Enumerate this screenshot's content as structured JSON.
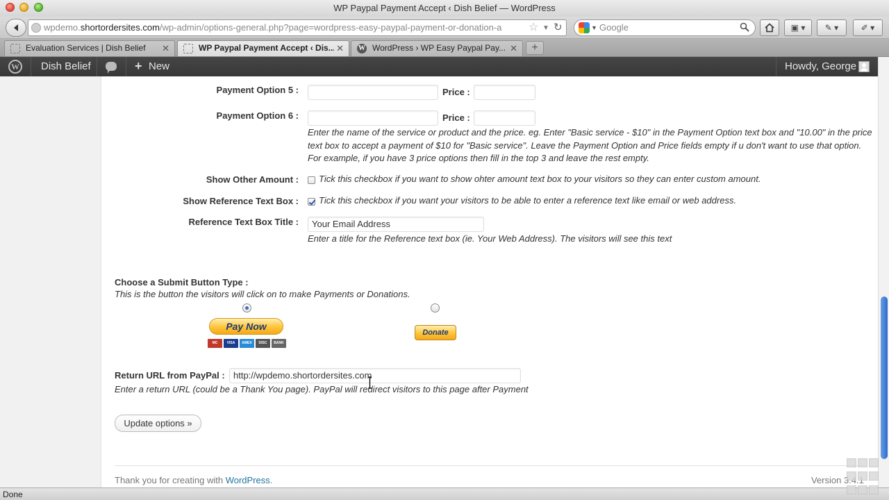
{
  "window": {
    "title": "WP Paypal Payment Accept ‹ Dish Belief — WordPress"
  },
  "navbar": {
    "url_prefix": "wpdemo.",
    "url_domain": "shortordersites.com",
    "url_path": "/wp-admin/options-general.php?page=wordpress-easy-paypal-payment-or-donation-a",
    "search_placeholder": "Google"
  },
  "tabs": [
    {
      "label": "Evaluation Services | Dish Belief",
      "active": false,
      "icon": "dashed-page-icon"
    },
    {
      "label": "WP Paypal Payment Accept ‹ Dis...",
      "active": true,
      "icon": "dashed-page-icon"
    },
    {
      "label": "WordPress › WP Easy Paypal Pay...",
      "active": false,
      "icon": "wordpress-icon"
    }
  ],
  "tab_close": "✕",
  "new_tab": "+",
  "adminbar": {
    "site_name": "Dish Belief",
    "new_label": "New",
    "howdy": "Howdy, George"
  },
  "form": {
    "option5_label": "Payment Option 5 :",
    "option6_label": "Payment Option 6 :",
    "price_label": "Price :",
    "option5_value": "",
    "option5_price": "",
    "option6_value": "",
    "option6_price": "",
    "payment_help": "Enter the name of the service or product and the price. eg. Enter \"Basic service - $10\" in the Payment Option text box and \"10.00\" in the price text box to accept a payment of $10 for \"Basic service\". Leave the Payment Option and Price fields empty if u don't want to use that option. For example, if you have 3 price options then fill in the top 3 and leave the rest empty.",
    "other_amount_label": "Show Other Amount :",
    "other_amount_checked": false,
    "other_amount_help": "Tick this checkbox if you want to show ohter amount text box to your visitors so they can enter custom amount.",
    "reference_label": "Show Reference Text Box :",
    "reference_checked": true,
    "reference_help": "Tick this checkbox if you want your visitors to be able to enter a reference text like email or web address.",
    "ref_title_label": "Reference Text Box Title :",
    "ref_title_value": "Your Email Address",
    "ref_title_help": "Enter a title for the Reference text box (ie. Your Web Address). The visitors will see this text",
    "submit_type_heading": "Choose a Submit Button Type :",
    "submit_type_help": "This is the button the visitors will click on to make Payments or Donations.",
    "pay_now_label": "Pay Now",
    "donate_label": "Donate",
    "selected_button": "Pay Now",
    "card_logos": [
      "MC",
      "VISA",
      "AMEX",
      "DISC",
      "BANK"
    ],
    "return_url_label": "Return URL from PayPal :",
    "return_url_value": "http://wpdemo.shortordersites.com",
    "return_url_help": "Enter a return URL (could be a Thank You page). PayPal will redirect visitors to this page after Payment",
    "update_button": "Update options »"
  },
  "footer": {
    "thanks_prefix": "Thank you for creating with ",
    "wordpress_link": "WordPress",
    "thanks_suffix": ".",
    "version": "Version 3.4.1"
  },
  "status": "Done",
  "colors": {
    "link": "#21759b",
    "paypal_gold": "#ffc439",
    "paypal_text": "#1b3a78",
    "adminbar": "#464646"
  }
}
